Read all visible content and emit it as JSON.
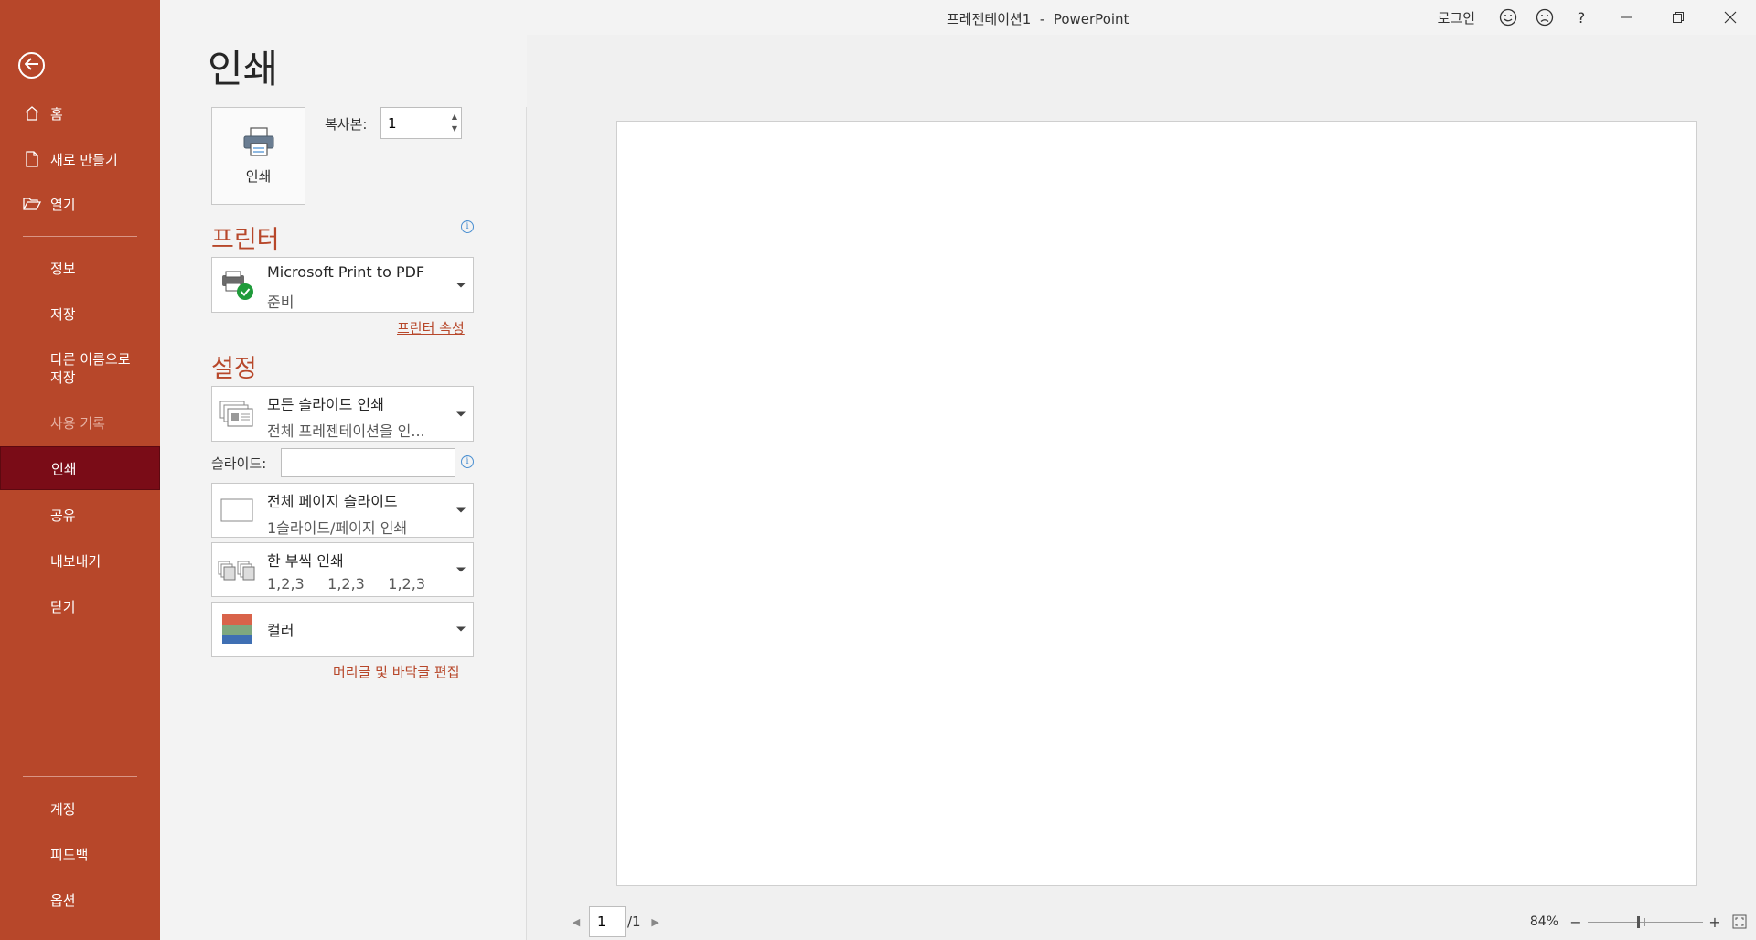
{
  "window": {
    "title": "프레젠테이션1  -  PowerPoint",
    "login_label": "로그인",
    "smile_icon": "smile-icon",
    "frown_icon": "frown-icon",
    "help_label": "?"
  },
  "sidebar": {
    "items": [
      {
        "label": "홈",
        "icon": "home-icon"
      },
      {
        "label": "새로 만들기",
        "icon": "new-doc-icon"
      },
      {
        "label": "열기",
        "icon": "folder-open-icon"
      },
      {
        "label": "정보"
      },
      {
        "label": "저장"
      },
      {
        "label": "다른 이름으로\n저장"
      },
      {
        "label": "사용 기록"
      },
      {
        "label": "인쇄"
      },
      {
        "label": "공유"
      },
      {
        "label": "내보내기"
      },
      {
        "label": "닫기"
      },
      {
        "label": "계정"
      },
      {
        "label": "피드백"
      },
      {
        "label": "옵션"
      }
    ],
    "active_index": 7,
    "accent_color": "#b7472a",
    "active_color": "#7a0c17"
  },
  "print": {
    "page_title": "인쇄",
    "print_button_label": "인쇄",
    "copies_label": "복사본:",
    "copies_value": "1",
    "printer_section_title": "프린터",
    "printer_name": "Microsoft Print to PDF",
    "printer_status": "준비",
    "printer_properties_link": "프린터 속성",
    "settings_section_title": "설정",
    "range": {
      "title": "모든 슬라이드 인쇄",
      "subtitle": "전체 프레젠테이션을 인..."
    },
    "slides_label": "슬라이드:",
    "slides_value": "",
    "layout": {
      "title": "전체 페이지 슬라이드",
      "subtitle": "1슬라이드/페이지 인쇄"
    },
    "collate": {
      "title": "한 부씩 인쇄",
      "subtitle": "1,2,3     1,2,3     1,2,3"
    },
    "color": {
      "title": "컬러"
    },
    "header_footer_link": "머리글 및 바닥글 편집"
  },
  "preview": {
    "current_page": "1",
    "total_pages": "/1",
    "zoom_percent": "84%"
  }
}
